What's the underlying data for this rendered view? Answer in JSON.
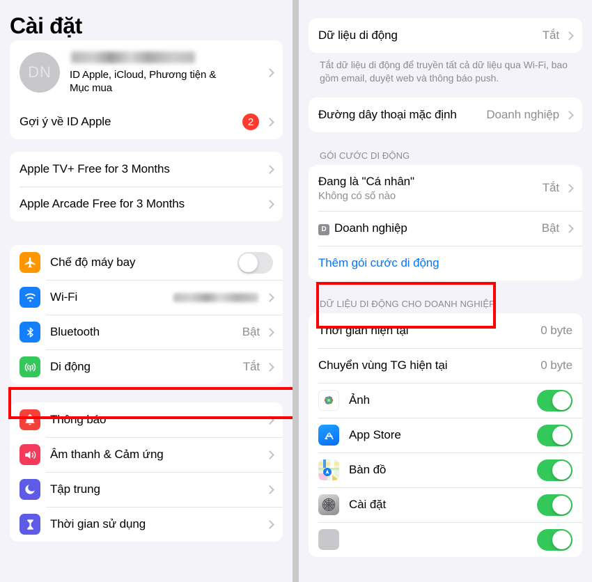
{
  "left": {
    "title": "Cài đặt",
    "apple_id": {
      "avatar_initials": "DN",
      "name_redacted": true,
      "subtitle": "ID Apple, iCloud, Phương tiện &\nMục mua"
    },
    "suggestion_row": {
      "label": "Gợi ý về ID Apple",
      "badge": "2"
    },
    "promo_rows": [
      {
        "label": "Apple TV+ Free for 3 Months"
      },
      {
        "label": "Apple Arcade Free for 3 Months"
      }
    ],
    "connectivity_rows": [
      {
        "label": "Chế độ máy bay",
        "icon": "airplane-icon",
        "control": "toggle",
        "toggle_on": false
      },
      {
        "label": "Wi-Fi",
        "icon": "wifi-icon",
        "control": "blurred-value"
      },
      {
        "label": "Bluetooth",
        "icon": "bluetooth-icon",
        "value": "Bật",
        "control": "chevron"
      },
      {
        "label": "Di động",
        "icon": "cellular-icon",
        "value": "Tắt",
        "control": "chevron",
        "highlighted": true
      }
    ],
    "system_rows": [
      {
        "label": "Thông báo",
        "icon": "notifications-icon"
      },
      {
        "label": "Âm thanh & Cảm ứng",
        "icon": "sound-icon"
      },
      {
        "label": "Tập trung",
        "icon": "focus-icon"
      },
      {
        "label": "Thời gian sử dụng",
        "icon": "screentime-icon"
      }
    ]
  },
  "right": {
    "cellular_data_row": {
      "label": "Dữ liệu di động",
      "value": "Tắt"
    },
    "cellular_data_footnote": "Tắt dữ liệu di động để truyền tất cả dữ liệu qua Wi-Fi, bao gồm email, duyệt web và thông báo push.",
    "default_line_row": {
      "label": "Đường dây thoại mặc định",
      "value": "Doanh nghiệp"
    },
    "plans_header": "GÓI CƯỚC DI ĐỘNG",
    "plans_rows": [
      {
        "label": "Đang là \"Cá nhân\"",
        "sublabel": "Không có số nào",
        "value": "Tắt"
      },
      {
        "label": "Doanh nghiệp",
        "badge_letter": "D",
        "value": "Bật"
      }
    ],
    "add_plan_link": "Thêm gói cước di động",
    "usage_header": "DỮ LIỆU DI ĐỘNG CHO DOANH NGHIỆP",
    "usage_rows": [
      {
        "label": "Thời gian hiện tại",
        "value": "0 byte"
      },
      {
        "label": "Chuyển vùng TG hiện tại",
        "value": "0 byte"
      }
    ],
    "app_rows": [
      {
        "label": "Ảnh",
        "icon": "photos-icon",
        "toggle_on": true
      },
      {
        "label": "App Store",
        "icon": "appstore-icon",
        "toggle_on": true
      },
      {
        "label": "Bàn đồ",
        "icon": "maps-icon",
        "toggle_on": true
      },
      {
        "label": "Cài đặt",
        "icon": "settings-icon",
        "toggle_on": true
      },
      {
        "label": "",
        "icon": "generic-app-icon",
        "toggle_on": true
      }
    ]
  },
  "colors": {
    "background": "#f4f3f9",
    "card": "#ffffff",
    "accent_link": "#0a74f0",
    "toggle_on": "#34c759",
    "badge_red": "#ff3b30",
    "highlight_red": "#ff0000",
    "secondary_text": "#8e8e93"
  }
}
